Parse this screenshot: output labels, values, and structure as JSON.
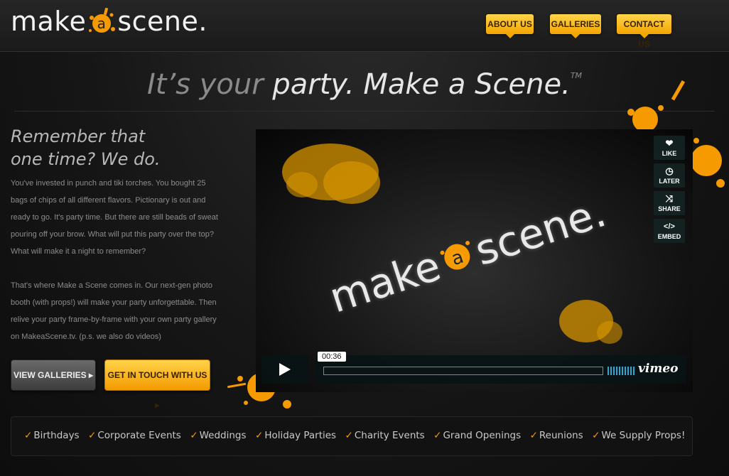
{
  "header": {
    "logo_left": "make",
    "logo_mid": "a",
    "logo_right": "scene.",
    "nav": [
      {
        "label": "ABOUT US"
      },
      {
        "label": "GALLERIES"
      },
      {
        "label": "CONTACT US"
      }
    ]
  },
  "tagline": {
    "part1": "It’s your ",
    "part2": "party.",
    "part3": " Make a Scene.",
    "tm": "TM"
  },
  "intro": {
    "heading_line1": "Remember that",
    "heading_line2": "one time? We do.",
    "paragraph1": "You've invested in punch and tiki torches. You bought 25 bags of chips of all different flavors. Pictionary is out and ready to go. It's party time. But there are still beads of sweat pouring off your brow. What will put this party over the top? What will make it a night to remember?",
    "paragraph2": "That's where Make a Scene comes in. Our next-gen photo booth (with props!) will make your party unforgettable. Then relive your party frame-by-frame with your own party gallery on MakeaScene.tv. (p.s. we also do videos)"
  },
  "buttons": {
    "view_galleries": "VIEW GALLERIES ▸",
    "get_in_touch": "GET IN TOUCH WITH US ▸"
  },
  "video": {
    "logo_left": "make",
    "logo_mid": "a",
    "logo_right": "scene.",
    "side_buttons": [
      {
        "label": "LIKE",
        "icon": "heart-icon",
        "glyph": "❤"
      },
      {
        "label": "LATER",
        "icon": "clock-icon",
        "glyph": "◷"
      },
      {
        "label": "SHARE",
        "icon": "share-icon",
        "glyph": "⤨"
      },
      {
        "label": "EMBED",
        "icon": "embed-icon",
        "glyph": "</>"
      }
    ],
    "time": "00:36",
    "brand": "vimeo",
    "volume_bars": 10
  },
  "features": [
    "Birthdays",
    "Corporate Events",
    "Weddings",
    "Holiday Parties",
    "Charity Events",
    "Grand Openings",
    "Reunions",
    "We Supply Props!"
  ],
  "colors": {
    "accent": "#f59a00",
    "accent_light": "#ffd44a",
    "background": "#161616",
    "player_accent": "#27a9d6"
  }
}
